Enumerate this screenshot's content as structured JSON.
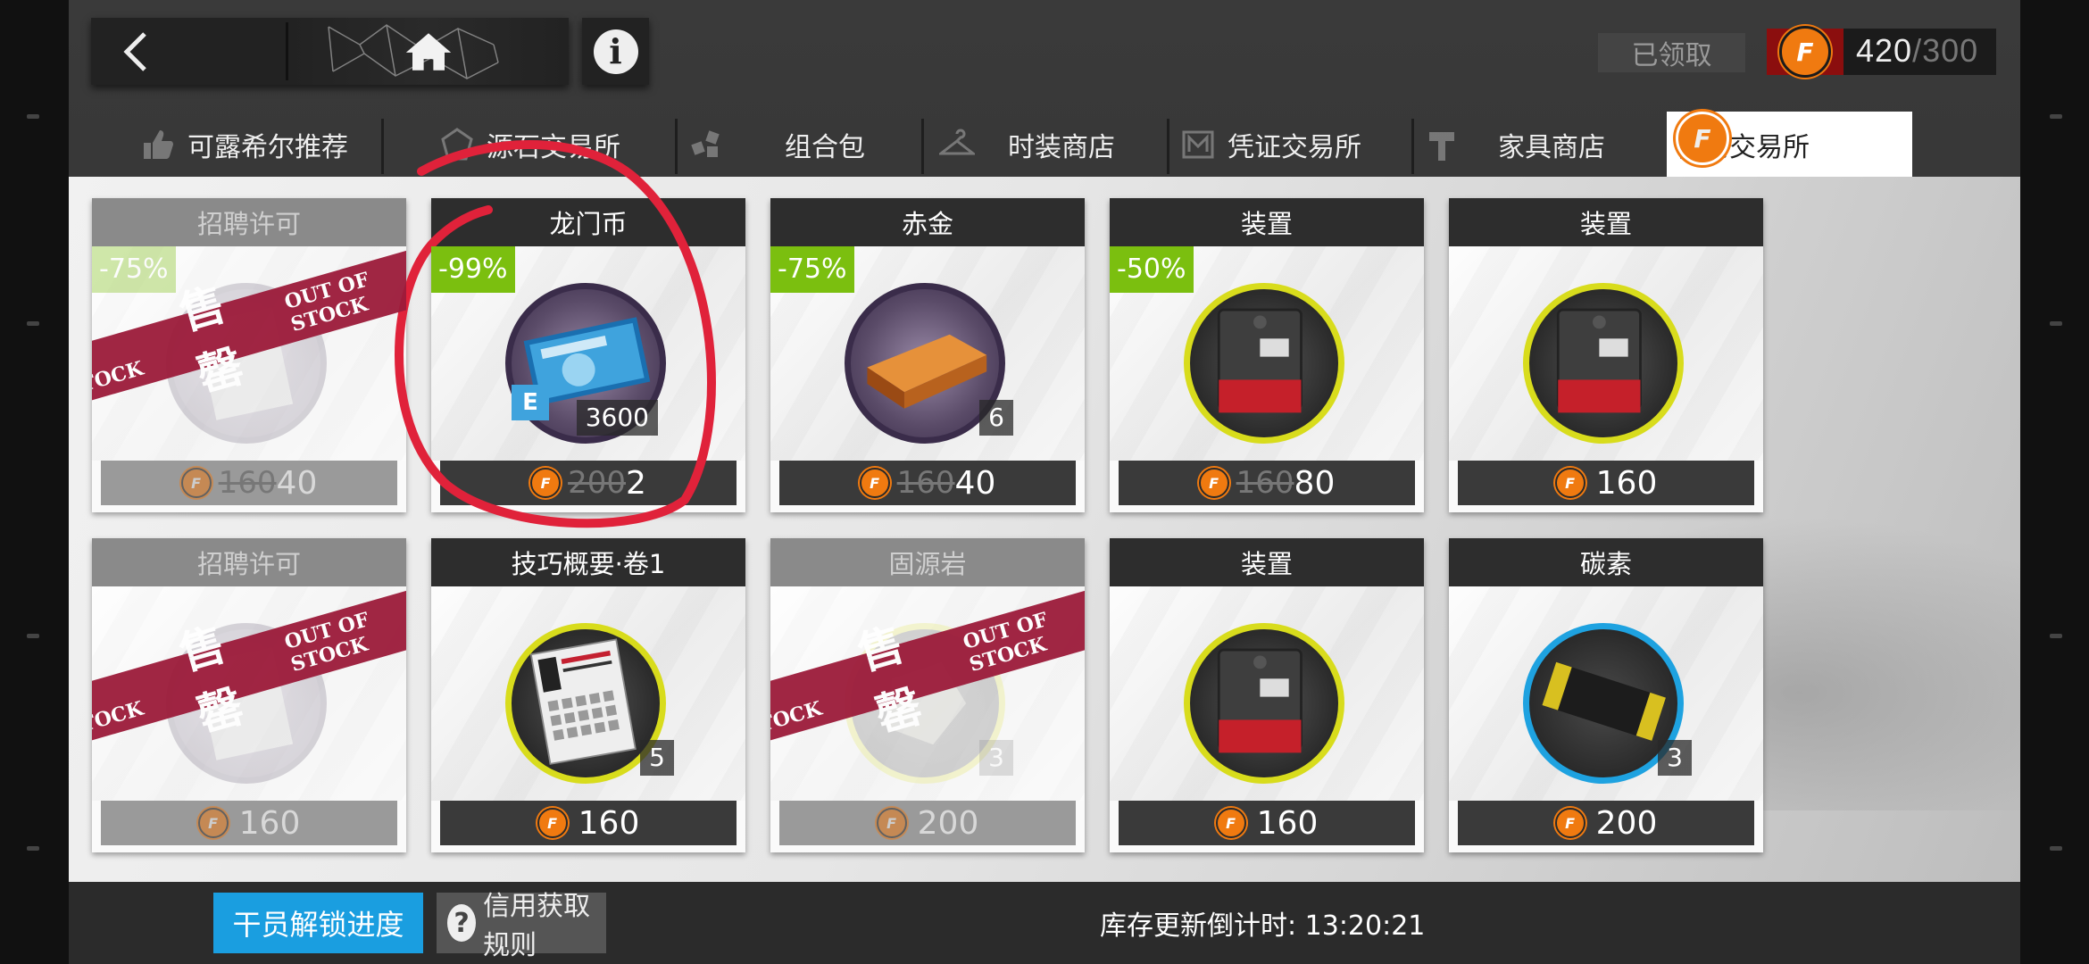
{
  "header": {
    "claimed_label": "已领取",
    "credit": {
      "current": "420",
      "separator": "/",
      "max": "300",
      "icon": "f-coin-icon"
    }
  },
  "tabs": [
    {
      "label": "可露希尔推荐",
      "icon": "thumbs-up-icon",
      "active": false
    },
    {
      "label": "源石交易所",
      "icon": "originium-icon",
      "active": false
    },
    {
      "label": "组合包",
      "icon": "package-icon",
      "active": false
    },
    {
      "label": "时装商店",
      "icon": "hanger-icon",
      "active": false
    },
    {
      "label": "凭证交易所",
      "icon": "voucher-icon",
      "active": false
    },
    {
      "label": "家具商店",
      "icon": "hammer-icon",
      "active": false
    },
    {
      "label": "信用交易所",
      "icon": "f-coin-icon",
      "active": true
    }
  ],
  "cards": [
    {
      "title": "招聘许可",
      "discount": "-75%",
      "old_price": "160",
      "price": "40",
      "sold_out": true
    },
    {
      "title": "龙门币",
      "discount": "-99%",
      "quantity": "3600",
      "old_price": "200",
      "price": "2",
      "sold_out": false
    },
    {
      "title": "赤金",
      "discount": "-75%",
      "quantity": "6",
      "old_price": "160",
      "price": "40",
      "sold_out": false
    },
    {
      "title": "装置",
      "discount": "-50%",
      "old_price": "160",
      "price": "80",
      "sold_out": false
    },
    {
      "title": "装置",
      "price": "160",
      "sold_out": false
    },
    {
      "title": "招聘许可",
      "price": "160",
      "sold_out": true
    },
    {
      "title": "技巧概要·卷1",
      "quantity": "5",
      "price": "160",
      "sold_out": false
    },
    {
      "title": "固源岩",
      "quantity": "3",
      "price": "200",
      "sold_out": true
    },
    {
      "title": "装置",
      "price": "160",
      "sold_out": false
    },
    {
      "title": "碳素",
      "quantity": "3",
      "price": "200",
      "sold_out": false
    }
  ],
  "sold_out_banner": {
    "cn": "售罄",
    "en_left": "OF STOCK",
    "en_right": "OUT OF STOCK"
  },
  "coin_glyph": "F",
  "bottom": {
    "unlock_label": "干员解锁进度",
    "rules_label": "信用获取规则",
    "timer_label": "库存更新倒计时: 13:20:21"
  },
  "colors": {
    "accent_orange": "#f07a10",
    "discount_green": "#7bbf0f",
    "soldout_banner": "#9c1b3a",
    "primary_blue": "#1a9ee0",
    "annotation_red": "#e0223a"
  }
}
